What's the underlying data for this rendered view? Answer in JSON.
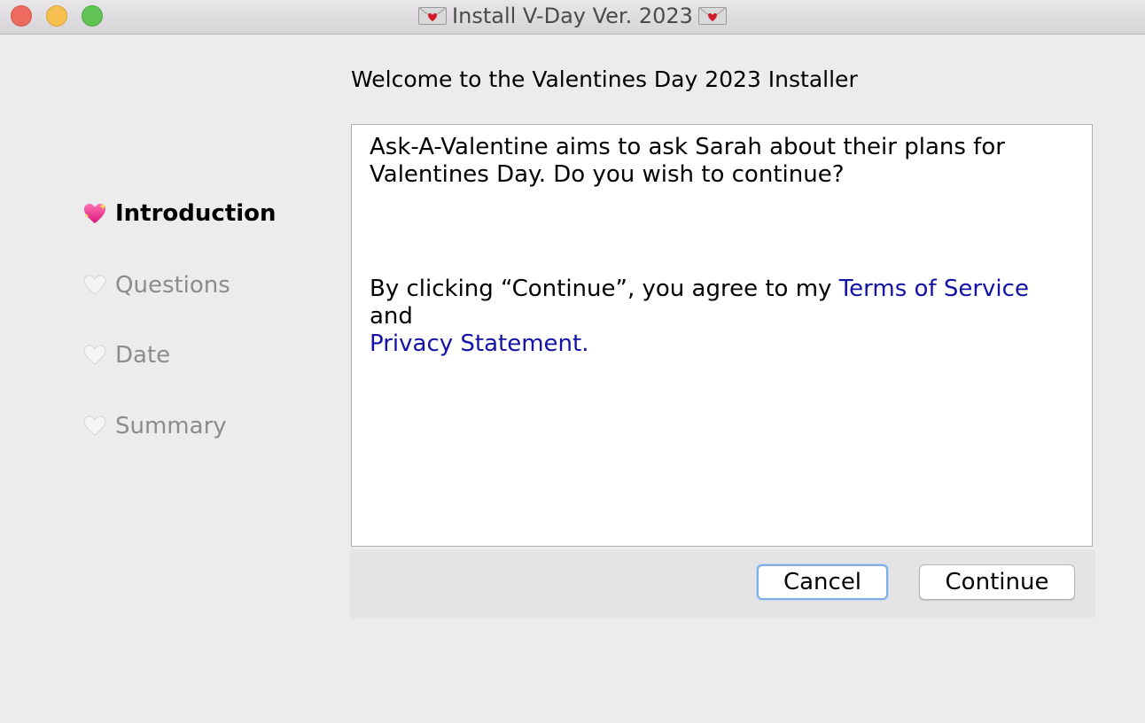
{
  "window": {
    "title": "Install V-Day Ver. 2023",
    "title_icon": "love-letter-icon"
  },
  "heading": "Welcome to the Valentines Day 2023 Installer",
  "steps": [
    {
      "label": "Introduction",
      "icon": "sparkling-heart-icon",
      "active": true
    },
    {
      "label": "Questions",
      "icon": "white-heart-icon",
      "active": false
    },
    {
      "label": "Date",
      "icon": "white-heart-icon",
      "active": false
    },
    {
      "label": "Summary",
      "icon": "white-heart-icon",
      "active": false
    }
  ],
  "content": {
    "paragraph1": "Ask-A-Valentine aims to ask Sarah about their plans for Valentines Day. Do you wish to continue?",
    "paragraph2_prefix": "By clicking “Continue”, you agree to my ",
    "terms_link": "Terms of Service",
    "paragraph2_mid": " and",
    "privacy_link": "Privacy Statement."
  },
  "buttons": {
    "cancel": "Cancel",
    "continue": "Continue"
  },
  "colors": {
    "link": "#1212a6",
    "active_step": "#000000",
    "inactive_step": "#8c8c8c",
    "close": "#ed6a5e",
    "minimize": "#f5bf4f",
    "maximize": "#61c454"
  }
}
